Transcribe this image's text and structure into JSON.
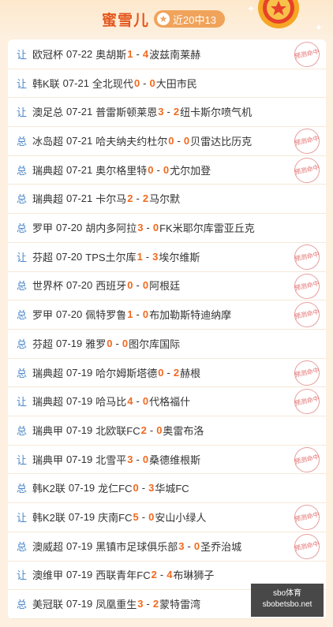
{
  "header": {
    "title": "蜜雪儿",
    "badge": "近20中13",
    "badge_icon": "star-icon",
    "medal_icon": "medal-icon"
  },
  "stamp_text": "预测命中",
  "colors": {
    "accent": "#e4581f",
    "score": "#f06a1f",
    "type": "#4a86c8",
    "badge": "#f0a35a"
  },
  "matches": [
    {
      "type": "让",
      "league": "欧冠杯",
      "date": "07-22",
      "home": "奥胡斯",
      "s1": "1",
      "s2": "4",
      "away": "波兹南莱赫",
      "hit": true
    },
    {
      "type": "让",
      "league": "韩K联",
      "date": "07-21",
      "home": "全北现代",
      "s1": "0",
      "s2": "0",
      "away": "大田市民",
      "hit": false
    },
    {
      "type": "让",
      "league": "澳足总",
      "date": "07-21",
      "home": "普雷斯顿莱恩",
      "s1": "3",
      "s2": "2",
      "away": "纽卡斯尔喷气机",
      "hit": false
    },
    {
      "type": "总",
      "league": "冰岛超",
      "date": "07-21",
      "home": "哈夫纳夫约杜尔",
      "s1": "0",
      "s2": "0",
      "away": "贝雷达比历克",
      "hit": true
    },
    {
      "type": "总",
      "league": "瑞典超",
      "date": "07-21",
      "home": "奥尔格里特",
      "s1": "0",
      "s2": "0",
      "away": "尤尔加登",
      "hit": true
    },
    {
      "type": "总",
      "league": "瑞典超",
      "date": "07-21",
      "home": "卡尔马",
      "s1": "2",
      "s2": "2",
      "away": "马尔默",
      "hit": false
    },
    {
      "type": "总",
      "league": "罗甲",
      "date": "07-20",
      "home": "胡内多阿拉",
      "s1": "3",
      "s2": "0",
      "away": "FK米耶尔库雷亚丘克",
      "hit": false
    },
    {
      "type": "让",
      "league": "芬超",
      "date": "07-20",
      "home": "TPS土尔库",
      "s1": "1",
      "s2": "3",
      "away": "埃尔维斯",
      "hit": true
    },
    {
      "type": "总",
      "league": "世界杯",
      "date": "07-20",
      "home": "西班牙",
      "s1": "0",
      "s2": "0",
      "away": "阿根廷",
      "hit": true
    },
    {
      "type": "总",
      "league": "罗甲",
      "date": "07-20",
      "home": "佩特罗鲁",
      "s1": "1",
      "s2": "0",
      "away": "布加勒斯特迪纳摩",
      "hit": true
    },
    {
      "type": "总",
      "league": "芬超",
      "date": "07-19",
      "home": "雅罗",
      "s1": "0",
      "s2": "0",
      "away": "图尔库国际",
      "hit": false
    },
    {
      "type": "总",
      "league": "瑞典超",
      "date": "07-19",
      "home": "哈尔姆斯塔德",
      "s1": "0",
      "s2": "2",
      "away": "赫根",
      "hit": true
    },
    {
      "type": "让",
      "league": "瑞典超",
      "date": "07-19",
      "home": "哈马比",
      "s1": "4",
      "s2": "0",
      "away": "代格福什",
      "hit": true
    },
    {
      "type": "总",
      "league": "瑞典甲",
      "date": "07-19",
      "home": "北欧联FC",
      "s1": "2",
      "s2": "0",
      "away": "奥雷布洛",
      "hit": false
    },
    {
      "type": "让",
      "league": "瑞典甲",
      "date": "07-19",
      "home": "北雪平",
      "s1": "3",
      "s2": "0",
      "away": "桑德维根斯",
      "hit": true
    },
    {
      "type": "总",
      "league": "韩K2联",
      "date": "07-19",
      "home": "龙仁FC",
      "s1": "0",
      "s2": "3",
      "away": "华城FC",
      "hit": false
    },
    {
      "type": "让",
      "league": "韩K2联",
      "date": "07-19",
      "home": "庆南FC",
      "s1": "5",
      "s2": "0",
      "away": "安山小绿人",
      "hit": true
    },
    {
      "type": "总",
      "league": "澳威超",
      "date": "07-19",
      "home": "黑镇市足球俱乐部",
      "s1": "3",
      "s2": "0",
      "away": "圣乔治城",
      "hit": true
    },
    {
      "type": "让",
      "league": "澳维甲",
      "date": "07-19",
      "home": "西联青年FC",
      "s1": "2",
      "s2": "4",
      "away": "布琳狮子",
      "hit": false
    },
    {
      "type": "总",
      "league": "美冠联",
      "date": "07-19",
      "home": "凤凰重生",
      "s1": "3",
      "s2": "2",
      "away": "蒙特雷湾",
      "hit": false
    }
  ],
  "watermark": {
    "line1": "sbo体育",
    "line2": "sbobetsbo.net"
  }
}
